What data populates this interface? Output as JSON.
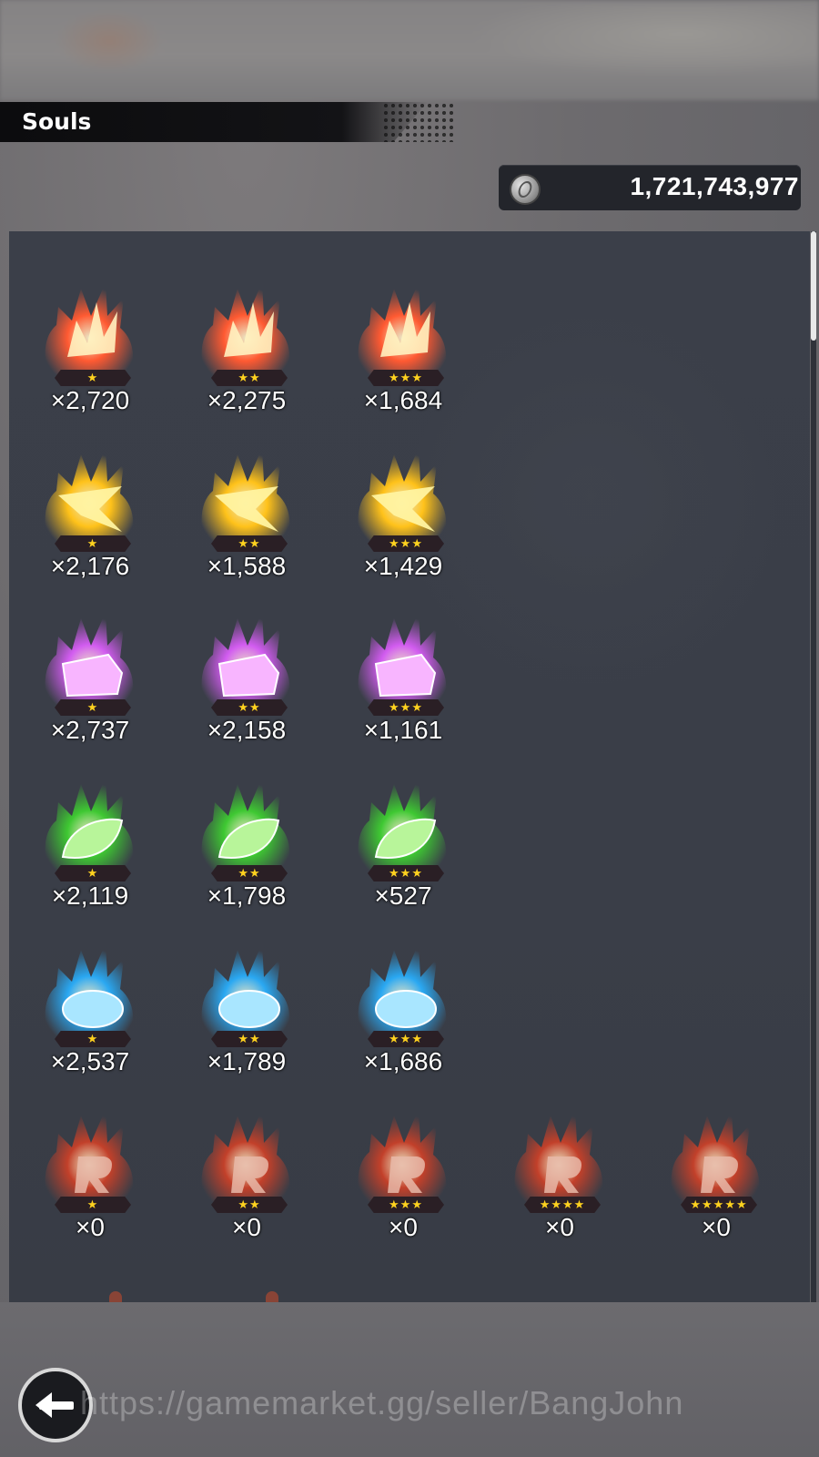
{
  "header": {
    "title": "Souls"
  },
  "currency": {
    "icon": "coin-icon",
    "amount": "1,721,743,977"
  },
  "colors": {
    "red": "#ff5a32",
    "yellow": "#ffc21a",
    "purple": "#d25cf0",
    "green": "#3ec832",
    "blue": "#2aa8f2",
    "rainbow": "#c2402a",
    "panel": "#3b3f49",
    "star": "#ffd21f"
  },
  "souls": [
    {
      "color": "red",
      "shape": "claw",
      "stars": "★",
      "qty": "×2,720"
    },
    {
      "color": "red",
      "shape": "claw",
      "stars": "★★",
      "qty": "×2,275"
    },
    {
      "color": "red",
      "shape": "claw",
      "stars": "★★★",
      "qty": "×1,684"
    },
    {
      "color": "yellow",
      "shape": "star",
      "stars": "★",
      "qty": "×2,176"
    },
    {
      "color": "yellow",
      "shape": "star",
      "stars": "★★",
      "qty": "×1,588"
    },
    {
      "color": "yellow",
      "shape": "star",
      "stars": "★★★",
      "qty": "×1,429"
    },
    {
      "color": "purple",
      "shape": "gem",
      "stars": "★",
      "qty": "×2,737"
    },
    {
      "color": "purple",
      "shape": "gem",
      "stars": "★★",
      "qty": "×2,158"
    },
    {
      "color": "purple",
      "shape": "gem",
      "stars": "★★★",
      "qty": "×1,161"
    },
    {
      "color": "green",
      "shape": "leaf",
      "stars": "★",
      "qty": "×2,119"
    },
    {
      "color": "green",
      "shape": "leaf",
      "stars": "★★",
      "qty": "×1,798"
    },
    {
      "color": "green",
      "shape": "leaf",
      "stars": "★★★",
      "qty": "×527"
    },
    {
      "color": "blue",
      "shape": "drop",
      "stars": "★",
      "qty": "×2,537"
    },
    {
      "color": "blue",
      "shape": "drop",
      "stars": "★★",
      "qty": "×1,789"
    },
    {
      "color": "blue",
      "shape": "drop",
      "stars": "★★★",
      "qty": "×1,686"
    },
    {
      "color": "rainbow",
      "shape": "r",
      "stars": "★",
      "qty": "×0"
    },
    {
      "color": "rainbow",
      "shape": "r",
      "stars": "★★",
      "qty": "×0"
    },
    {
      "color": "rainbow",
      "shape": "r",
      "stars": "★★★",
      "qty": "×0"
    },
    {
      "color": "rainbow",
      "shape": "r",
      "stars": "★★★★",
      "qty": "×0"
    },
    {
      "color": "rainbow",
      "shape": "r",
      "stars": "★★★★★",
      "qty": "×0"
    }
  ],
  "back_button": {
    "icon": "back-arrow-icon"
  },
  "watermark": "https://gamemarket.gg/seller/BangJohn"
}
